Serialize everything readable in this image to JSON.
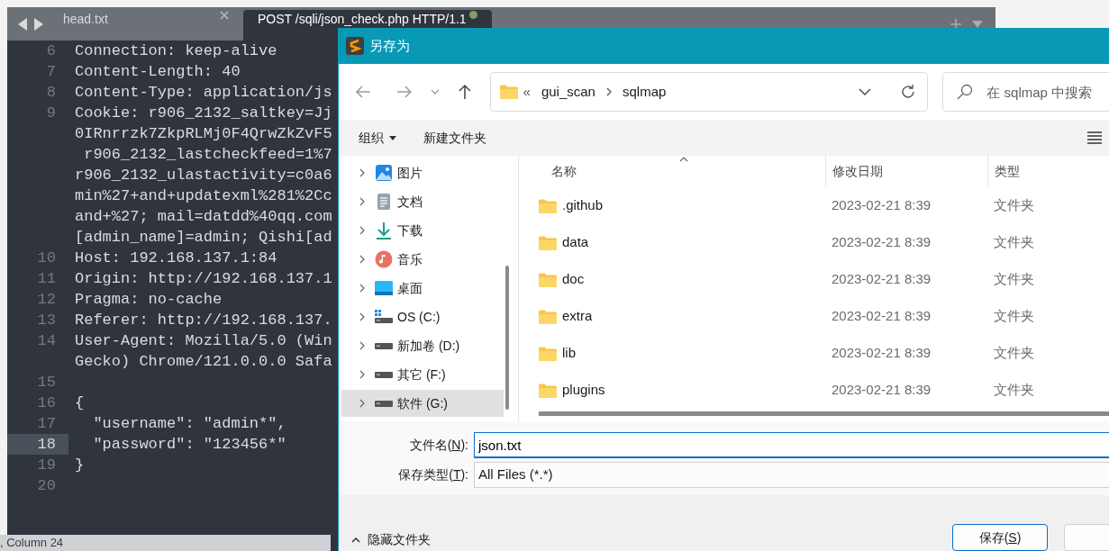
{
  "editor": {
    "tabs": [
      {
        "label": "head.txt",
        "selected": false,
        "modified": false
      },
      {
        "label": "POST /sqli/json_check.php HTTP/1.1",
        "selected": true,
        "modified": true
      }
    ],
    "lines": [
      {
        "number": "6",
        "selected": false,
        "text": [
          "Connection: keep-alive"
        ]
      },
      {
        "number": "7",
        "selected": false,
        "text": [
          "Content-Length: 40"
        ]
      },
      {
        "number": "8",
        "selected": false,
        "text": [
          "Content-Type: application/js"
        ]
      },
      {
        "number": "9",
        "selected": false,
        "text": [
          "Cookie: r906_2132_saltkey=Jj",
          "0IRnrrzk7ZkpRLMj0F4QrwZkZvF5",
          " r906_2132_lastcheckfeed=1%7",
          "r906_2132_ulastactivity=c0a6",
          "min%27+and+updatexml%281%2Cc",
          "and+%27; mail=datdd%40qq.com",
          "[admin_name]=admin; Qishi[ad"
        ]
      },
      {
        "number": "10",
        "selected": false,
        "text": [
          "Host: 192.168.137.1:84"
        ]
      },
      {
        "number": "11",
        "selected": false,
        "text": [
          "Origin: http://192.168.137.1"
        ]
      },
      {
        "number": "12",
        "selected": false,
        "text": [
          "Pragma: no-cache"
        ]
      },
      {
        "number": "13",
        "selected": false,
        "text": [
          "Referer: http://192.168.137."
        ]
      },
      {
        "number": "14",
        "selected": false,
        "text": [
          "User-Agent: Mozilla/5.0 (Win",
          "Gecko) Chrome/121.0.0.0 Safa"
        ]
      },
      {
        "number": "15",
        "selected": false
      },
      {
        "number": "16",
        "selected": false,
        "text": [
          "{"
        ]
      },
      {
        "number": "17",
        "selected": false,
        "text": [
          "  \"username\": \"admin*\","
        ]
      },
      {
        "number": "18",
        "selected": true,
        "text": [
          "  \"password\": \"123456*\""
        ]
      },
      {
        "number": "19",
        "selected": false,
        "text": [
          "}"
        ]
      },
      {
        "number": "20",
        "selected": false
      }
    ],
    "status_bar": ", Column 24"
  },
  "dialog": {
    "title": "另存为",
    "address": {
      "overflow": "«",
      "path": [
        "gui_scan",
        "sqlmap"
      ]
    },
    "search": {
      "placeholder": "在 sqlmap 中搜索"
    },
    "toolbar": {
      "organize": "组织",
      "new_folder": "新建文件夹"
    },
    "tree": [
      {
        "label": "图片",
        "kind": "pictures",
        "selected": false
      },
      {
        "label": "文档",
        "kind": "documents",
        "selected": false
      },
      {
        "label": "下载",
        "kind": "downloads",
        "selected": false
      },
      {
        "label": "音乐",
        "kind": "music",
        "selected": false
      },
      {
        "label": "桌面",
        "kind": "desktop",
        "selected": false
      },
      {
        "label": "OS (C:)",
        "kind": "system-drive",
        "selected": false
      },
      {
        "label": "新加卷 (D:)",
        "kind": "drive",
        "selected": false
      },
      {
        "label": "其它 (F:)",
        "kind": "drive",
        "selected": false
      },
      {
        "label": "软件 (G:)",
        "kind": "drive",
        "selected": true
      }
    ],
    "columns": [
      "名称",
      "修改日期",
      "类型"
    ],
    "rows": [
      {
        "name": ".github",
        "date": "2023-02-21 8:39",
        "type": "文件夹"
      },
      {
        "name": "data",
        "date": "2023-02-21 8:39",
        "type": "文件夹"
      },
      {
        "name": "doc",
        "date": "2023-02-21 8:39",
        "type": "文件夹"
      },
      {
        "name": "extra",
        "date": "2023-02-21 8:39",
        "type": "文件夹"
      },
      {
        "name": "lib",
        "date": "2023-02-21 8:39",
        "type": "文件夹"
      },
      {
        "name": "plugins",
        "date": "2023-02-21 8:39",
        "type": "文件夹"
      }
    ],
    "file_name": {
      "label_before": "文件名(",
      "accelerator": "N",
      "label_after": "):",
      "value": "json.txt"
    },
    "file_type": {
      "label_before": "保存类型(",
      "accelerator": "T",
      "label_after": "):",
      "value": "All Files (*.*)"
    },
    "hide_folders": "隐藏文件夹",
    "save_button": {
      "label_before": "保存(",
      "accelerator": "S",
      "label_after": ")"
    }
  }
}
